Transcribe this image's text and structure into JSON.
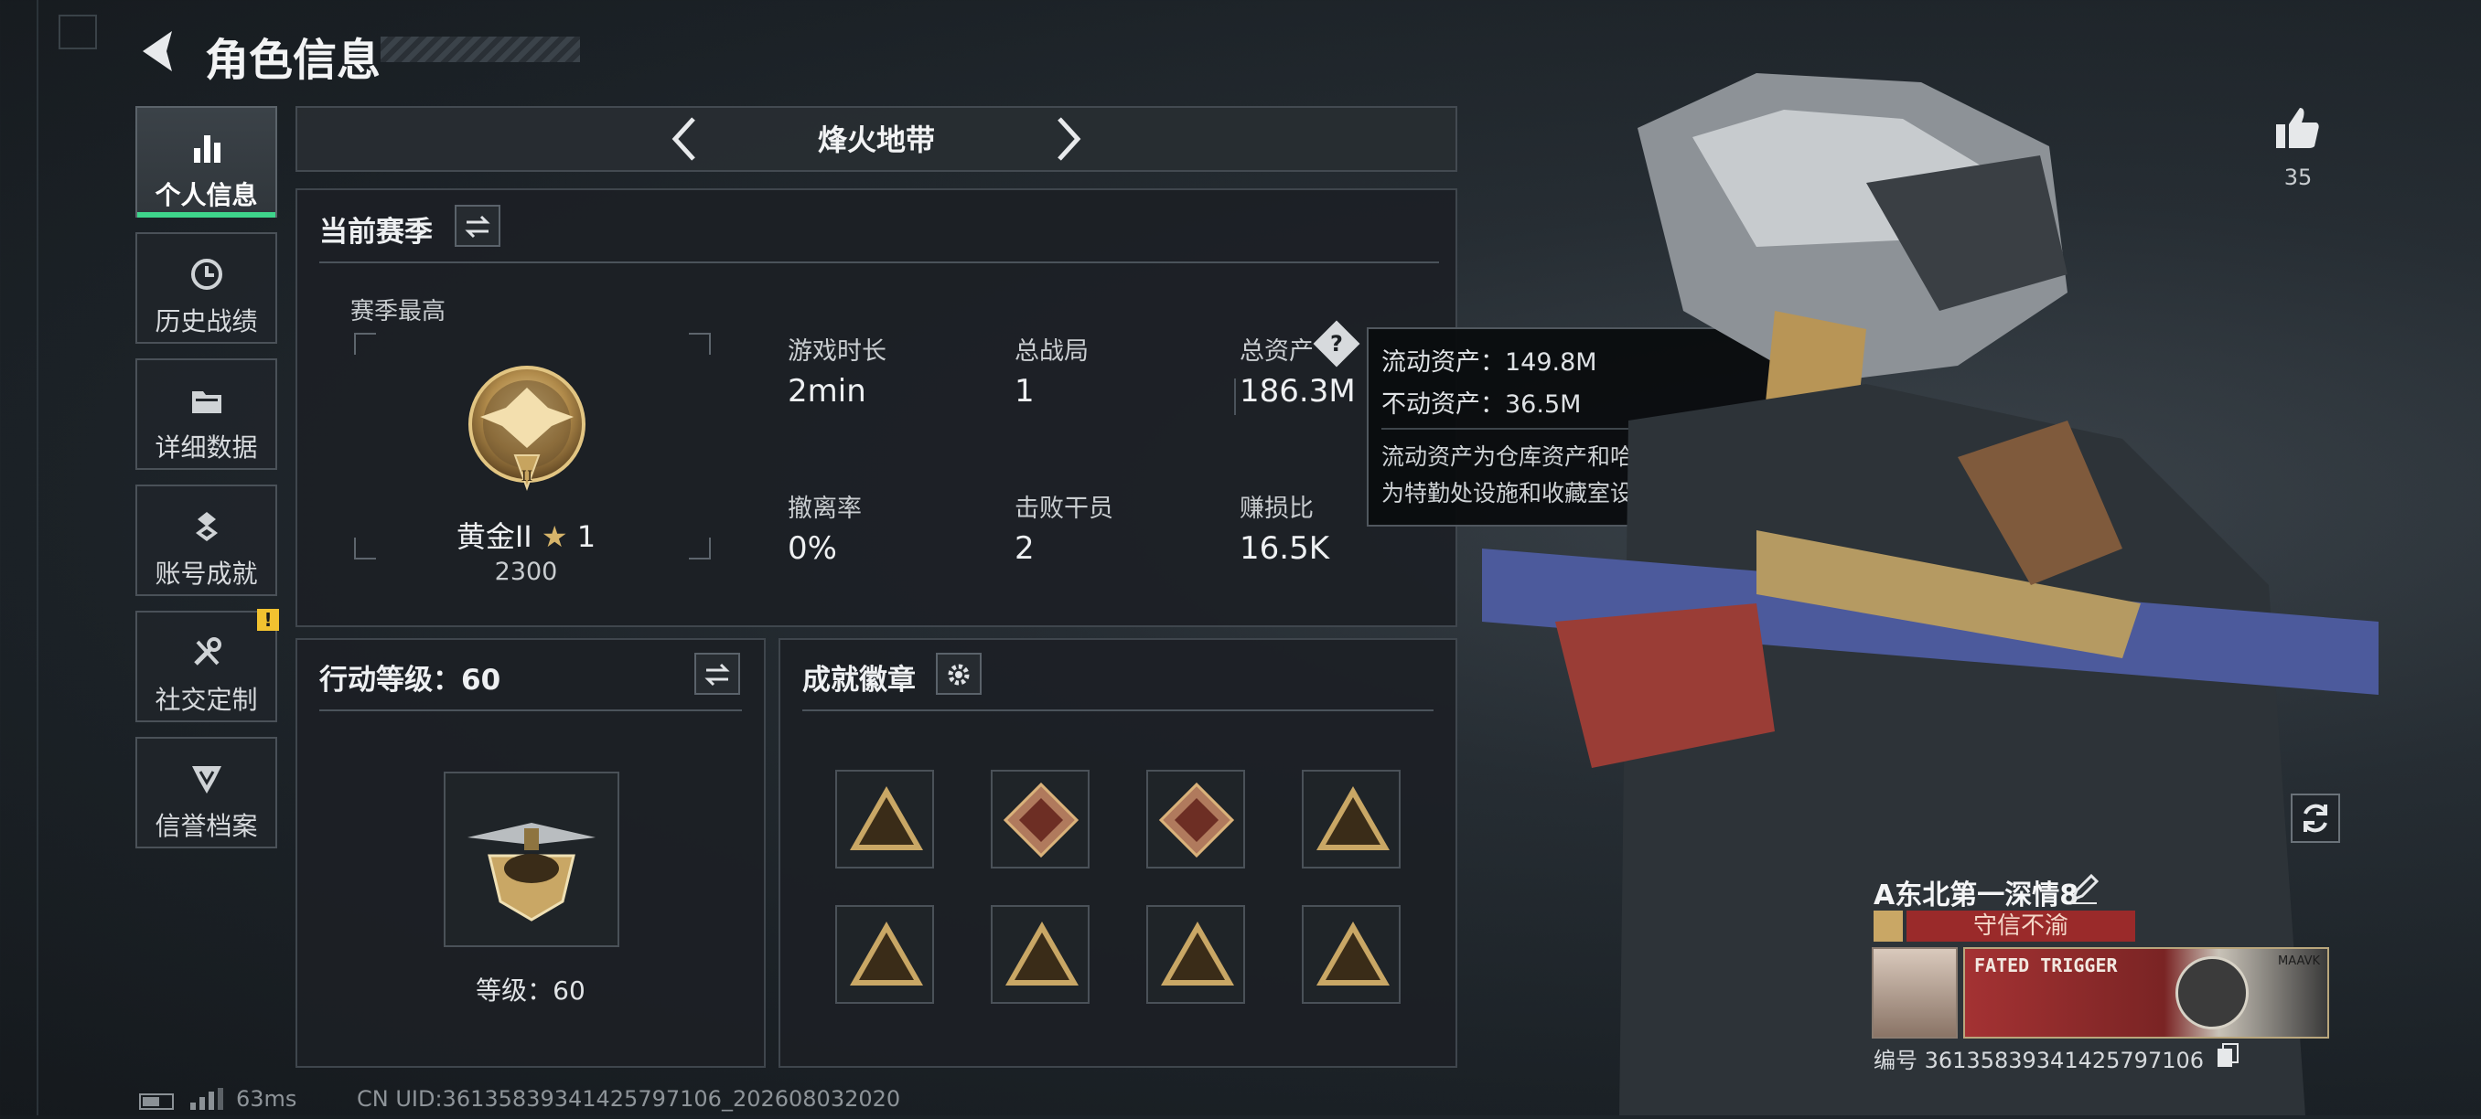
{
  "header": {
    "title": "角色信息"
  },
  "nav": {
    "items": [
      {
        "label": "个人信息",
        "icon": "bar-chart-icon",
        "active": true
      },
      {
        "label": "历史战绩",
        "icon": "history-clock-icon",
        "active": false
      },
      {
        "label": "详细数据",
        "icon": "folder-icon",
        "active": false
      },
      {
        "label": "账号成就",
        "icon": "achievement-badge-icon",
        "active": false
      },
      {
        "label": "社交定制",
        "icon": "wrench-tools-icon",
        "active": false,
        "alert": "!"
      },
      {
        "label": "信誉档案",
        "icon": "shield-check-icon",
        "active": false
      }
    ]
  },
  "mode": {
    "title": "烽火地带"
  },
  "season": {
    "title": "当前赛季",
    "best_label": "赛季最高",
    "rank_name": "黄金II",
    "rank_stars": "1",
    "rank_points": "2300",
    "rank_emblem_numeral": "II",
    "stats": [
      {
        "label": "游戏时长",
        "value": "2min"
      },
      {
        "label": "总战局",
        "value": "1"
      },
      {
        "label": "总资产",
        "value": "186.3M",
        "help": "?"
      },
      {
        "label": "撤离率",
        "value": "0%"
      },
      {
        "label": "击败干员",
        "value": "2"
      },
      {
        "label": "赚损比",
        "value": "16.5K"
      }
    ]
  },
  "tooltip": {
    "line1": "流动资产：149.8M",
    "line2": "不动资产：36.5M",
    "desc_line1": "流动资产为仓库资产和哈夫币，不动资产",
    "desc_line2": "为特勤处设施和收藏室设施"
  },
  "action_level": {
    "title": "行动等级：60",
    "level_label": "等级：60"
  },
  "achievements": {
    "title": "成就徽章",
    "badges": [
      "sniper-triangle-badge",
      "wolf-diamond-badge",
      "dragon-diamond-badge",
      "vehicle-triangle-badge",
      "supply-triangle-badge",
      "tower-triangle-badge",
      "shield-triangle-badge",
      "soldiers-triangle-badge"
    ]
  },
  "likes": {
    "count": "35"
  },
  "profile": {
    "name": "A东北第一深情8",
    "title_tag": "守信不渝",
    "card_text": "FATED TRIGGER",
    "card_brand": "MAAVK",
    "id_line": "编号 361358393414257971​06"
  },
  "footer": {
    "ping": "63ms",
    "uid": "CN UID:361358393414257971​06_202608032020"
  },
  "colors": {
    "accent_green": "#3ed48b",
    "gold": "#c9a765",
    "alert_yellow": "#f2c230",
    "tag_red": "#9a2a2a"
  }
}
